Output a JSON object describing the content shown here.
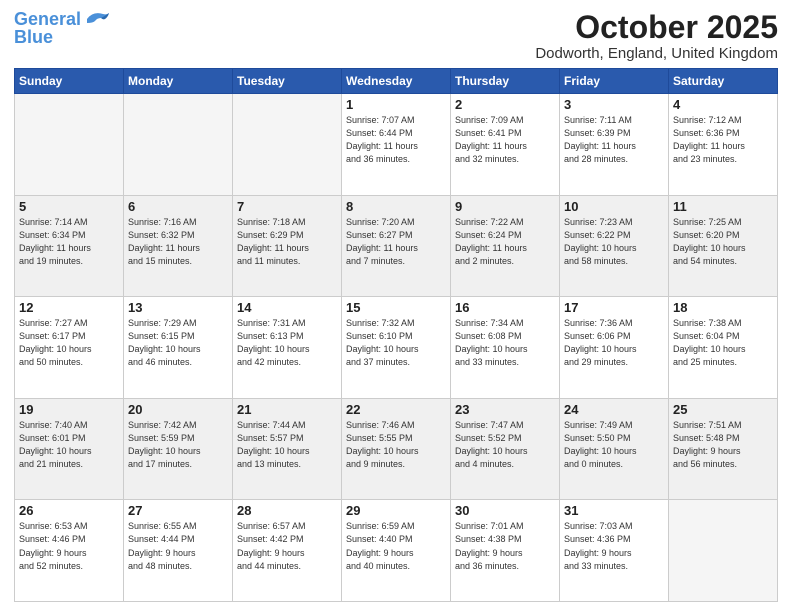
{
  "header": {
    "logo_line1": "General",
    "logo_line2": "Blue",
    "month": "October 2025",
    "location": "Dodworth, England, United Kingdom"
  },
  "days_of_week": [
    "Sunday",
    "Monday",
    "Tuesday",
    "Wednesday",
    "Thursday",
    "Friday",
    "Saturday"
  ],
  "weeks": [
    [
      {
        "day": "",
        "info": ""
      },
      {
        "day": "",
        "info": ""
      },
      {
        "day": "",
        "info": ""
      },
      {
        "day": "1",
        "info": "Sunrise: 7:07 AM\nSunset: 6:44 PM\nDaylight: 11 hours\nand 36 minutes."
      },
      {
        "day": "2",
        "info": "Sunrise: 7:09 AM\nSunset: 6:41 PM\nDaylight: 11 hours\nand 32 minutes."
      },
      {
        "day": "3",
        "info": "Sunrise: 7:11 AM\nSunset: 6:39 PM\nDaylight: 11 hours\nand 28 minutes."
      },
      {
        "day": "4",
        "info": "Sunrise: 7:12 AM\nSunset: 6:36 PM\nDaylight: 11 hours\nand 23 minutes."
      }
    ],
    [
      {
        "day": "5",
        "info": "Sunrise: 7:14 AM\nSunset: 6:34 PM\nDaylight: 11 hours\nand 19 minutes."
      },
      {
        "day": "6",
        "info": "Sunrise: 7:16 AM\nSunset: 6:32 PM\nDaylight: 11 hours\nand 15 minutes."
      },
      {
        "day": "7",
        "info": "Sunrise: 7:18 AM\nSunset: 6:29 PM\nDaylight: 11 hours\nand 11 minutes."
      },
      {
        "day": "8",
        "info": "Sunrise: 7:20 AM\nSunset: 6:27 PM\nDaylight: 11 hours\nand 7 minutes."
      },
      {
        "day": "9",
        "info": "Sunrise: 7:22 AM\nSunset: 6:24 PM\nDaylight: 11 hours\nand 2 minutes."
      },
      {
        "day": "10",
        "info": "Sunrise: 7:23 AM\nSunset: 6:22 PM\nDaylight: 10 hours\nand 58 minutes."
      },
      {
        "day": "11",
        "info": "Sunrise: 7:25 AM\nSunset: 6:20 PM\nDaylight: 10 hours\nand 54 minutes."
      }
    ],
    [
      {
        "day": "12",
        "info": "Sunrise: 7:27 AM\nSunset: 6:17 PM\nDaylight: 10 hours\nand 50 minutes."
      },
      {
        "day": "13",
        "info": "Sunrise: 7:29 AM\nSunset: 6:15 PM\nDaylight: 10 hours\nand 46 minutes."
      },
      {
        "day": "14",
        "info": "Sunrise: 7:31 AM\nSunset: 6:13 PM\nDaylight: 10 hours\nand 42 minutes."
      },
      {
        "day": "15",
        "info": "Sunrise: 7:32 AM\nSunset: 6:10 PM\nDaylight: 10 hours\nand 37 minutes."
      },
      {
        "day": "16",
        "info": "Sunrise: 7:34 AM\nSunset: 6:08 PM\nDaylight: 10 hours\nand 33 minutes."
      },
      {
        "day": "17",
        "info": "Sunrise: 7:36 AM\nSunset: 6:06 PM\nDaylight: 10 hours\nand 29 minutes."
      },
      {
        "day": "18",
        "info": "Sunrise: 7:38 AM\nSunset: 6:04 PM\nDaylight: 10 hours\nand 25 minutes."
      }
    ],
    [
      {
        "day": "19",
        "info": "Sunrise: 7:40 AM\nSunset: 6:01 PM\nDaylight: 10 hours\nand 21 minutes."
      },
      {
        "day": "20",
        "info": "Sunrise: 7:42 AM\nSunset: 5:59 PM\nDaylight: 10 hours\nand 17 minutes."
      },
      {
        "day": "21",
        "info": "Sunrise: 7:44 AM\nSunset: 5:57 PM\nDaylight: 10 hours\nand 13 minutes."
      },
      {
        "day": "22",
        "info": "Sunrise: 7:46 AM\nSunset: 5:55 PM\nDaylight: 10 hours\nand 9 minutes."
      },
      {
        "day": "23",
        "info": "Sunrise: 7:47 AM\nSunset: 5:52 PM\nDaylight: 10 hours\nand 4 minutes."
      },
      {
        "day": "24",
        "info": "Sunrise: 7:49 AM\nSunset: 5:50 PM\nDaylight: 10 hours\nand 0 minutes."
      },
      {
        "day": "25",
        "info": "Sunrise: 7:51 AM\nSunset: 5:48 PM\nDaylight: 9 hours\nand 56 minutes."
      }
    ],
    [
      {
        "day": "26",
        "info": "Sunrise: 6:53 AM\nSunset: 4:46 PM\nDaylight: 9 hours\nand 52 minutes."
      },
      {
        "day": "27",
        "info": "Sunrise: 6:55 AM\nSunset: 4:44 PM\nDaylight: 9 hours\nand 48 minutes."
      },
      {
        "day": "28",
        "info": "Sunrise: 6:57 AM\nSunset: 4:42 PM\nDaylight: 9 hours\nand 44 minutes."
      },
      {
        "day": "29",
        "info": "Sunrise: 6:59 AM\nSunset: 4:40 PM\nDaylight: 9 hours\nand 40 minutes."
      },
      {
        "day": "30",
        "info": "Sunrise: 7:01 AM\nSunset: 4:38 PM\nDaylight: 9 hours\nand 36 minutes."
      },
      {
        "day": "31",
        "info": "Sunrise: 7:03 AM\nSunset: 4:36 PM\nDaylight: 9 hours\nand 33 minutes."
      },
      {
        "day": "",
        "info": ""
      }
    ]
  ]
}
